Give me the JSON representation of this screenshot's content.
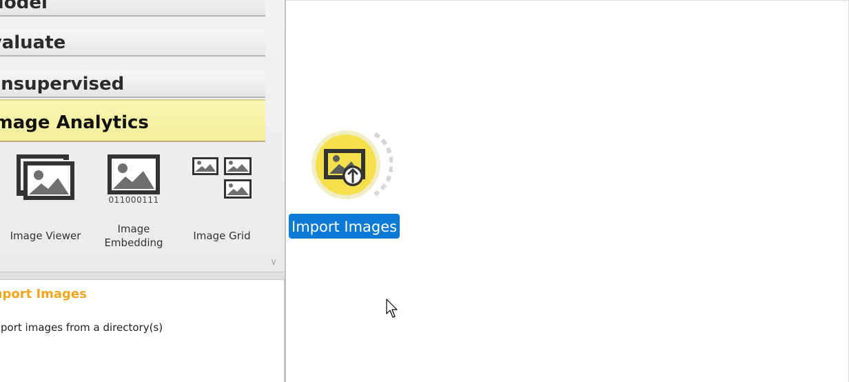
{
  "toolbox": {
    "categories": {
      "model": "Model",
      "evaluate": "Evaluate",
      "unsupervised": "Unsupervised",
      "image_analytics": "Image Analytics"
    },
    "widgets": [
      {
        "label": "Image Viewer",
        "icon": "image-viewer-icon"
      },
      {
        "label_line1": "Image",
        "label_line2": "Embedding",
        "icon": "image-embedding-icon",
        "caption": "011000111"
      },
      {
        "label": "Image Grid",
        "icon": "image-grid-icon"
      }
    ]
  },
  "description": {
    "title": "Import Images",
    "text": "Import images from a directory(s)"
  },
  "canvas": {
    "node": {
      "label": "Import Images",
      "icon": "import-images-icon",
      "accent": "#f4e04a"
    }
  },
  "colors": {
    "category_highlight": "#f4ef9a",
    "node_label_bg": "#0b7ad6",
    "desc_title": "#f0a51c"
  }
}
